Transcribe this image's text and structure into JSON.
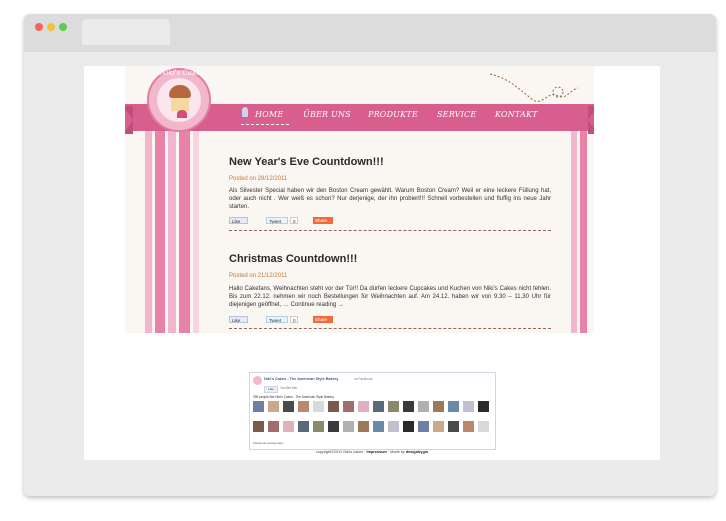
{
  "browser": {
    "window_controls": [
      "close",
      "minimize",
      "maximize"
    ]
  },
  "site": {
    "logo_text": "Niki's Cakes",
    "nav": [
      "HOME",
      "ÜBER UNS",
      "PRODUKTE",
      "SERVICE",
      "KONTAKT"
    ],
    "active_nav": "HOME",
    "colors": {
      "accent": "#d85f8d",
      "stripe_light": "#f3b5cb",
      "date": "#c27a37"
    }
  },
  "posts": [
    {
      "title": "New Year's Eve Countdown!!!",
      "date": "Posted on 28/12/2011",
      "body": "Als Silvester Special haben wir den Boston Cream gewählt. Warum Boston Cream? Weil er eine leckere Füllung hat, oder auch nicht . Wer weiß es schon? Nur derjenige, der ihn probiert!!! Schnell vorbestellen und fluffig ins neue Jahr starten.",
      "like": "Like",
      "tweet": "Tweet",
      "tweet_count": "0",
      "share": "Share"
    },
    {
      "title": "Christmas Countdown!!!",
      "date": "Posted on 21/12/2011",
      "body": "Hallo Cakefans, Weihnachten steht vor der Tür!! Da dürfen leckere Cupcakes und Kuchen von Niki's Cakes nicht fehlen. Bis zum 22.12. nehmen wir noch Bestellungen für Weihnachten auf. Am 24.12. haben wir von 9.30 – 11.30 Uhr für diejenigen geöffnet, … Continue reading →",
      "like": "Like",
      "tweet": "Tweet",
      "tweet_count": "0",
      "share": "Share"
    }
  ],
  "facebook_widget": {
    "title": "Niki's Cakes - The American Style Bakery",
    "subtitle": "on Facebook",
    "like_button": "Like",
    "you_like": "You like this.",
    "count_text": "395 people like Niki's Cakes - The American Style Bakery",
    "footer": "Facebook social plugin"
  },
  "footer": {
    "copyright": "copyright©2011 Niki's cakes ·",
    "impressum": "Impressum",
    "made_by": "· Made by",
    "designer": "designbygio"
  }
}
